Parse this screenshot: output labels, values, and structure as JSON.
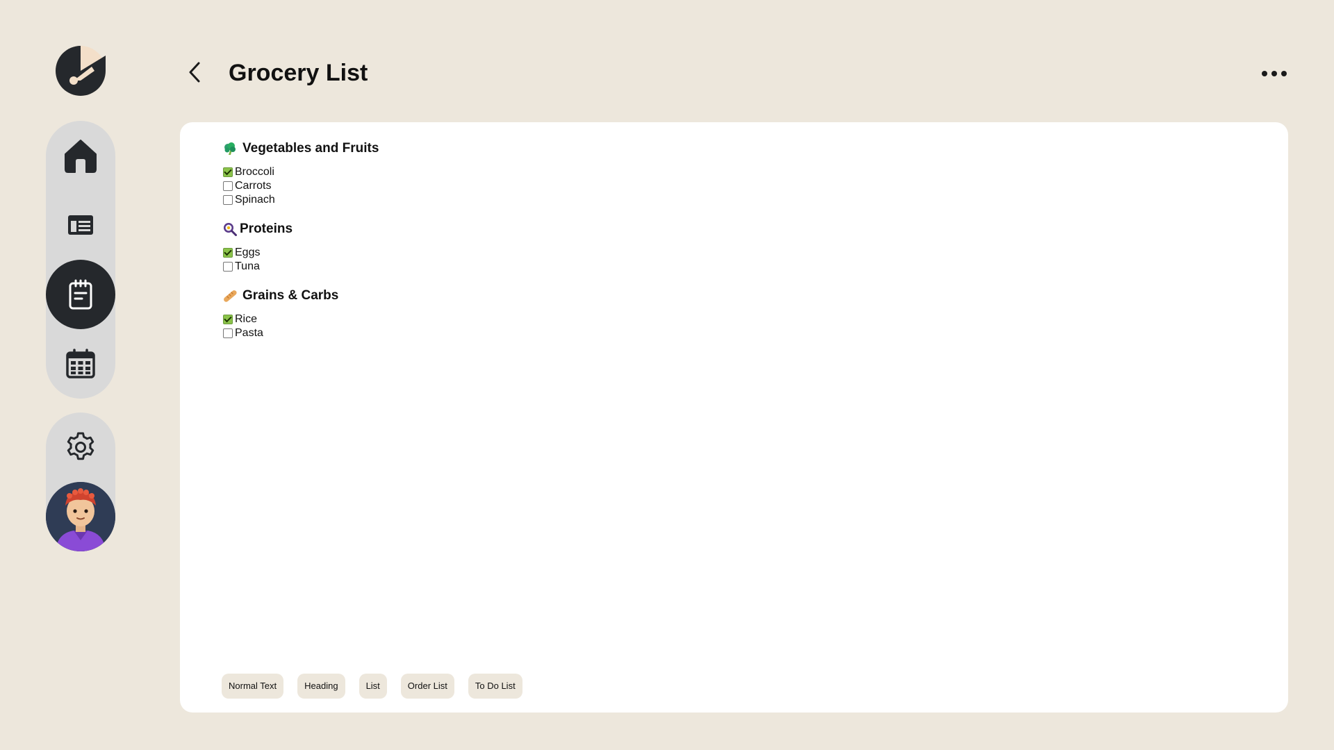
{
  "app": {
    "logo_icon": "app-logo-icon"
  },
  "sidebar": {
    "items": [
      {
        "name": "home",
        "icon": "home-icon",
        "active": false
      },
      {
        "name": "dashboard",
        "icon": "layout-icon",
        "active": false
      },
      {
        "name": "notes",
        "icon": "notepad-icon",
        "active": true
      },
      {
        "name": "calendar",
        "icon": "calendar-icon",
        "active": false
      }
    ],
    "settings_icon": "gear-icon",
    "avatar_icon": "avatar-icon"
  },
  "header": {
    "title": "Grocery List",
    "back_icon": "chevron-left-icon",
    "more_icon": "more-horizontal-icon"
  },
  "document": {
    "sections": [
      {
        "emoji": "🥦",
        "heading": "Vegetables and Fruits",
        "items": [
          {
            "label": "Broccoli",
            "checked": true
          },
          {
            "label": "Carrots",
            "checked": false
          },
          {
            "label": "Spinach",
            "checked": false
          }
        ]
      },
      {
        "emoji": "🍳",
        "heading": "Proteins",
        "items": [
          {
            "label": "Eggs",
            "checked": true
          },
          {
            "label": "Tuna",
            "checked": false
          }
        ]
      },
      {
        "emoji": "🥖",
        "heading": "Grains & Carbs",
        "items": [
          {
            "label": "Rice",
            "checked": true
          },
          {
            "label": "Pasta",
            "checked": false
          }
        ]
      }
    ]
  },
  "format_bar": {
    "buttons": [
      "Normal Text",
      "Heading",
      "List",
      "Order List",
      "To Do List"
    ]
  },
  "colors": {
    "background": "#ede7dc",
    "card": "#ffffff",
    "nav_pill": "#d9d9d9",
    "active_nav": "#25282c",
    "check_accent": "#8bc34a"
  }
}
